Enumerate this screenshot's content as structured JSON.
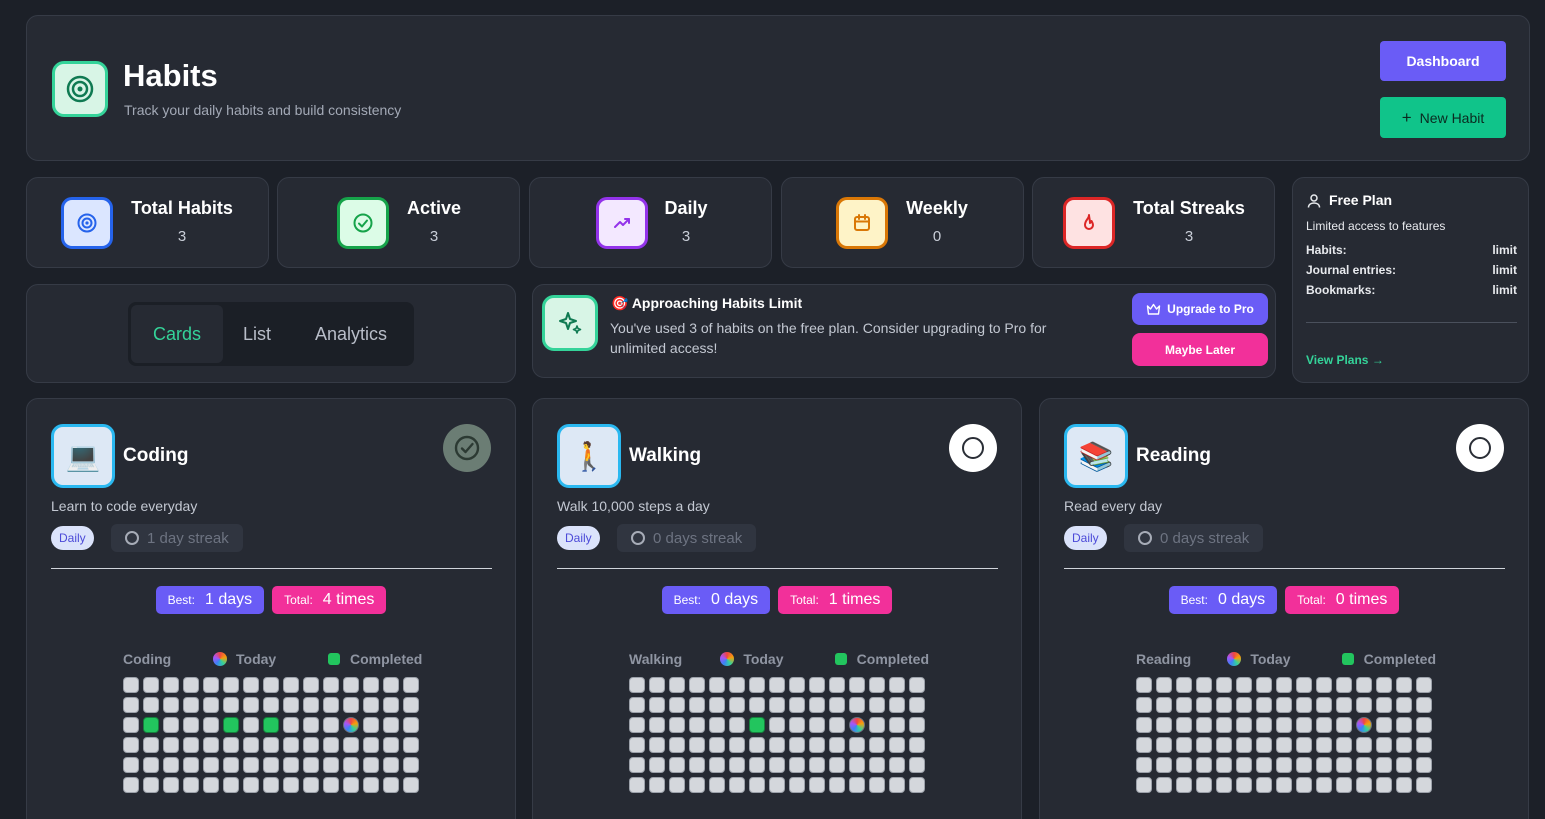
{
  "header": {
    "title": "Habits",
    "subtitle": "Track your daily habits and build consistency",
    "dashboard_label": "Dashboard",
    "new_habit_label": "New Habit"
  },
  "stats": [
    {
      "label": "Total Habits",
      "value": "3",
      "color": "#2563eb",
      "bg": "#dbe6ff"
    },
    {
      "label": "Active",
      "value": "3",
      "color": "#16a34a",
      "bg": "#dcfce7"
    },
    {
      "label": "Daily",
      "value": "3",
      "color": "#9333ea",
      "bg": "#f3e8ff"
    },
    {
      "label": "Weekly",
      "value": "0",
      "color": "#d97706",
      "bg": "#fef3c7"
    },
    {
      "label": "Total Streaks",
      "value": "3",
      "color": "#dc2626",
      "bg": "#fee2e2"
    }
  ],
  "plan": {
    "title": "Free Plan",
    "description": "Limited access to features",
    "rows": [
      {
        "label": "Habits:",
        "value": "limit"
      },
      {
        "label": "Journal entries:",
        "value": "limit"
      },
      {
        "label": "Bookmarks:",
        "value": "limit"
      }
    ],
    "link": "View Plans →"
  },
  "tabs": [
    {
      "label": "Cards",
      "active": true
    },
    {
      "label": "List",
      "active": false
    },
    {
      "label": "Analytics",
      "active": false
    }
  ],
  "banner": {
    "title": "Approaching Habits Limit",
    "emoji": "🎯",
    "text": "You've used 3 of habits on the free plan. Consider upgrading to Pro for unlimited access!",
    "upgrade_label": "Upgrade to Pro",
    "later_label": "Maybe Later"
  },
  "habits": [
    {
      "name": "Coding",
      "icon": "💻",
      "description": "Learn to code everyday",
      "frequency": "Daily",
      "streak": "1 day streak",
      "best_label": "Best:",
      "best": "1 days",
      "total_label": "Total:",
      "total": "4 times",
      "completed_today": true,
      "legend_today": "Today",
      "legend_completed": "Completed",
      "done_cells": [
        31,
        35,
        37
      ],
      "today_cell": 41
    },
    {
      "name": "Walking",
      "icon": "🚶",
      "description": "Walk 10,000 steps a day",
      "frequency": "Daily",
      "streak": "0 days streak",
      "best_label": "Best:",
      "best": "0 days",
      "total_label": "Total:",
      "total": "1 times",
      "completed_today": false,
      "legend_today": "Today",
      "legend_completed": "Completed",
      "done_cells": [
        36
      ],
      "today_cell": 41
    },
    {
      "name": "Reading",
      "icon": "📚",
      "description": "Read every day",
      "frequency": "Daily",
      "streak": "0 days streak",
      "best_label": "Best:",
      "best": "0 days",
      "total_label": "Total:",
      "total": "0 times",
      "completed_today": false,
      "legend_today": "Today",
      "legend_completed": "Completed",
      "done_cells": [],
      "today_cell": 41
    }
  ]
}
